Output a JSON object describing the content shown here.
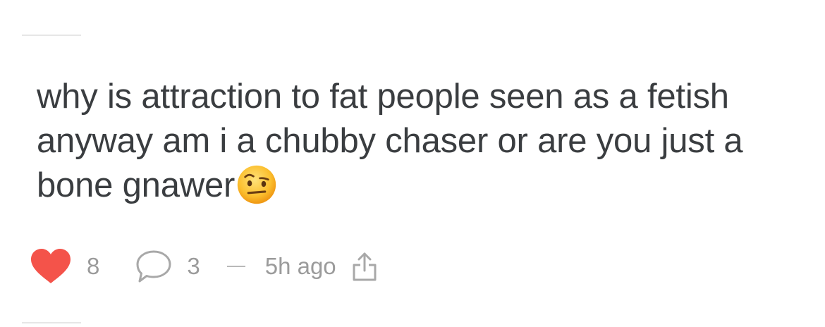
{
  "post": {
    "text": "why is attraction to fat people seen as a fetish anyway am i a chubby chaser or are you just a bone gnawer",
    "emoji": "face-with-raised-eyebrow"
  },
  "actions": {
    "likes": "8",
    "comments": "3",
    "time": "5h ago"
  },
  "colors": {
    "heart": "#f4534a",
    "meta_text": "#9b9b9b",
    "post_text": "#3a3d40",
    "divider": "#e6e6e6"
  },
  "icons": {
    "like": "heart-icon",
    "comment": "speech-bubble-icon",
    "share": "share-icon"
  }
}
